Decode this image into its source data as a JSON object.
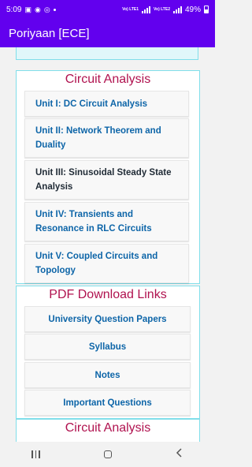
{
  "status_bar": {
    "time": "5:09",
    "net_label_1": "Vo) LTE1",
    "net_label_2": "Vo) LTE2",
    "battery": "49%"
  },
  "app_bar": {
    "title": "Poriyaan [ECE]"
  },
  "circuit_section": {
    "title": "Circuit Analysis",
    "units": [
      "Unit I: DC Circuit Analysis",
      "Unit II: Network Theorem and Duality",
      "Unit III: Sinusoidal Steady State Analysis",
      "Unit IV: Transients and Resonance in RLC Circuits",
      "Unit V: Coupled Circuits and Topology"
    ]
  },
  "pdf_section": {
    "title": "PDF Download Links",
    "links": [
      "University Question Papers",
      "Syllabus",
      "Notes",
      "Important Questions"
    ]
  },
  "next_section": {
    "title": "Circuit Analysis"
  },
  "nav_bar": {
    "icons": [
      "recent-apps-icon",
      "home-icon",
      "back-icon"
    ]
  }
}
